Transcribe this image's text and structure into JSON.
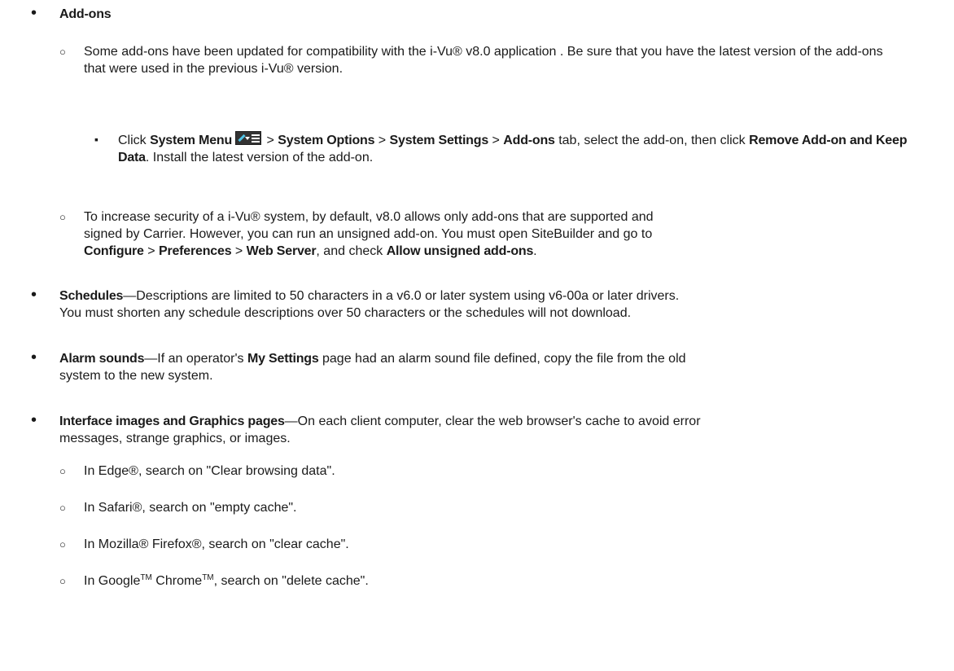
{
  "addons": {
    "title": "Add-ons",
    "sub1": {
      "text": "Some add-ons have been updated for compatibility with the i-Vu® v8.0 application . Be sure that you have the latest version of the add-ons that were used in the previous i-Vu® version."
    },
    "step": {
      "click": "Click ",
      "system_menu": "System Menu",
      "sep1": " > ",
      "system_options": "System Options",
      "sep2": " > ",
      "system_settings": "System Settings",
      "sep3": " > ",
      "addons_tab": "Add-ons",
      "after_tab": " tab, select the add-on, then click ",
      "remove_keep": "Remove Add-on and Keep Data",
      "after_remove": ". Install the latest version of the add-on."
    },
    "sub2": {
      "text_line1": "To increase security of a i-Vu® system, by default, v8.0 allows only add-ons that are supported and",
      "text_line2": "signed by Carrier. However, you can run an unsigned add-on. You must open SiteBuilder and go to",
      "configure": "Configure",
      "sep1": " > ",
      "preferences": "Preferences",
      "sep2": " > ",
      "web_server": "Web Server",
      "after_web": ", and check ",
      "allow_unsigned": "Allow unsigned add-ons",
      "end": "."
    }
  },
  "schedules": {
    "title": "Schedules",
    "text_line1": "—Descriptions are limited to 50 characters in a v6.0 or later system using v6-00a or later drivers.",
    "text_line2": "You must shorten any schedule descriptions over 50 characters or the schedules will not download."
  },
  "alarm": {
    "title": "Alarm sounds",
    "text_a": "—If an operator's ",
    "my_settings": "My Settings",
    "text_b": " page had an alarm sound file defined, copy the file from the old",
    "text_line2": "system to the new system."
  },
  "interface": {
    "title": "Interface images and Graphics pages",
    "text_line1": "—On each client computer, clear the web browser's cache to avoid error",
    "text_line2": "messages, strange graphics, or images.",
    "browsers": [
      "In Edge®, search on \"Clear browsing data\".",
      "In Safari®, search on \"empty cache\".",
      "In Mozilla® Firefox®, search on \"clear cache\"."
    ],
    "chrome": {
      "a": "In Google",
      "tm1": "TM",
      "b": " Chrome",
      "tm2": "TM",
      "c": ", search on \"delete cache\"."
    }
  }
}
